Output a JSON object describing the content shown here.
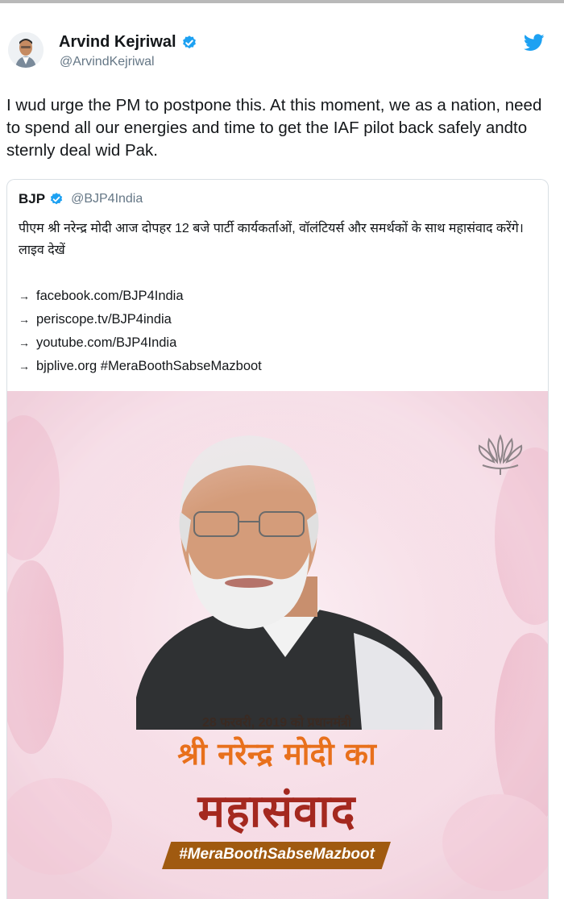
{
  "tweet": {
    "author_name": "Arvind Kejriwal",
    "author_handle": "@ArvindKejriwal",
    "text": "I wud urge the PM to postpone this. At this moment, we as a nation, need to spend all our energies and time to get the IAF pilot back safely andto sternly deal wid Pak.",
    "icons": [
      "avatar",
      "verified-badge-icon",
      "twitter-bird-icon"
    ]
  },
  "quoted_tweet": {
    "author_name": "BJP",
    "author_handle": "@BJP4India",
    "text": "पीएम श्री नरेन्द्र मोदी आज दोपहर 12 बजे पार्टी कार्यकर्ताओं, वॉलंटियर्स और समर्थकों के साथ महासंवाद करेंगे। लाइव देखें",
    "links": [
      "facebook.com/BJP4India",
      "periscope.tv/BJP4india",
      "youtube.com/BJP4India",
      "bjplive.org #MeraBoothSabseMazboot"
    ],
    "arrow_glyph": "→",
    "media": {
      "date_line": "28 फरवरी, 2019 को प्रधानमंत्री",
      "name_line": "श्री नरेन्द्र मोदी का",
      "event_line": "महासंवाद",
      "hashtag": "#MeraBoothSabseMazboot",
      "colors": {
        "name": "#e8701c",
        "event": "#a4281f",
        "band": "#a05a10",
        "background": "#f6dde6"
      }
    }
  },
  "colors": {
    "twitter_blue": "#1da1f2",
    "text": "#14171a",
    "secondary": "#657786",
    "border": "#d9dfe4"
  }
}
